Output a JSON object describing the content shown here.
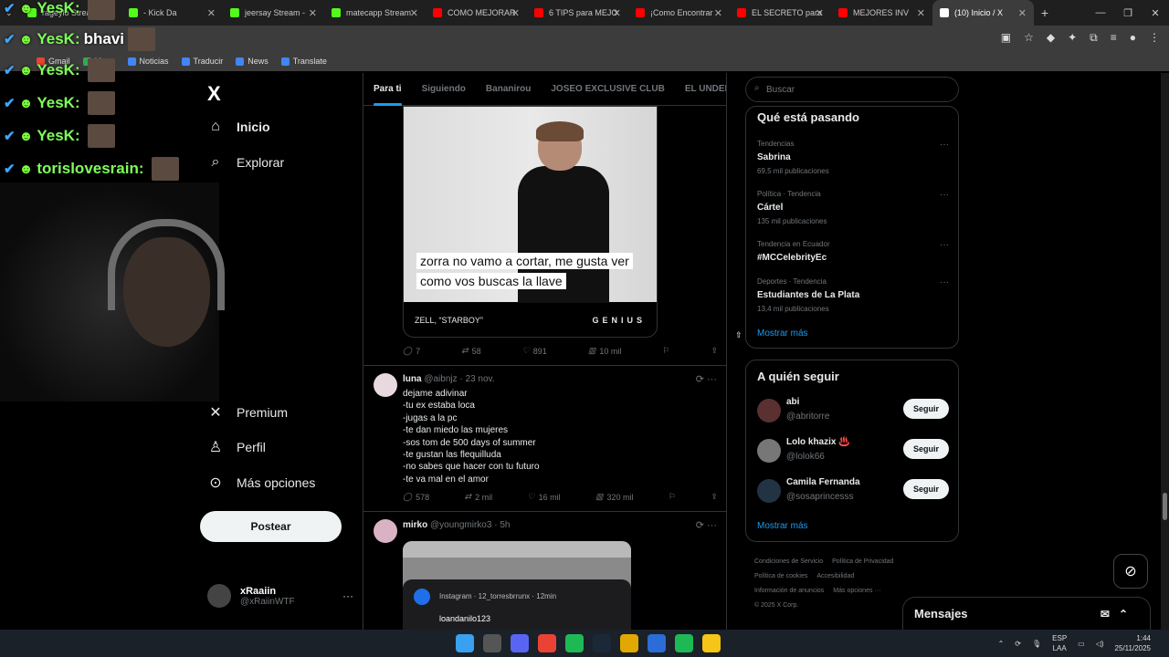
{
  "browser": {
    "tabs": [
      {
        "title": "rageylo Strea",
        "color": "#53fc18"
      },
      {
        "title": "- Kick Da",
        "color": "#53fc18"
      },
      {
        "title": "jeersay Stream - ",
        "color": "#53fc18"
      },
      {
        "title": "matecapp Stream",
        "color": "#53fc18"
      },
      {
        "title": "COMO MEJORAR",
        "color": "#ff0000"
      },
      {
        "title": "6 TIPS para MEJO",
        "color": "#ff0000"
      },
      {
        "title": "¡Como Encontrar",
        "color": "#ff0000"
      },
      {
        "title": "EL SECRETO para",
        "color": "#ff0000"
      },
      {
        "title": "MEJORES INV",
        "color": "#ff0000"
      },
      {
        "title": "(10) Inicio / X",
        "color": "#ffffff"
      }
    ],
    "bookmarks": [
      {
        "label": "Gmail",
        "color": "#ea4335"
      },
      {
        "label": "Maps",
        "color": "#34a853"
      },
      {
        "label": "Noticias",
        "color": "#4285f4"
      },
      {
        "label": "Traducir",
        "color": "#4285f4"
      },
      {
        "label": "News",
        "color": "#4285f4"
      },
      {
        "label": "Translate",
        "color": "#4285f4"
      }
    ]
  },
  "overlay": {
    "chat": [
      {
        "nick": "YesK:",
        "text": ""
      },
      {
        "nick": "YesK:",
        "text": "bhavi"
      },
      {
        "nick": "YesK:",
        "text": ""
      },
      {
        "nick": "YesK:",
        "text": ""
      },
      {
        "nick": "YesK:",
        "text": ""
      },
      {
        "nick": "torislovesrain:",
        "text": ""
      }
    ]
  },
  "nav": {
    "logo": "X",
    "items": [
      {
        "label": "Inicio",
        "icon": "home-icon"
      },
      {
        "label": "Explorar",
        "icon": "search-icon"
      },
      {
        "label": "Premium",
        "icon": "x-premium-icon"
      },
      {
        "label": "Perfil",
        "icon": "person-icon"
      },
      {
        "label": "Más opciones",
        "icon": "more-circle-icon"
      }
    ],
    "post_label": "Postear",
    "profile": {
      "name": "xRaaiin",
      "handle": "@xRaiinWTF"
    }
  },
  "feed": {
    "tabs": [
      "Para ti",
      "Siguiendo",
      "Bananirou",
      "JOSEO EXCLUSIVE CLUB",
      "EL UNDER."
    ],
    "post1": {
      "caption_line1": "zorra no vamo a cortar, me gusta ver",
      "caption_line2": "como vos buscas la llave",
      "source": "ZELL, “STARBOY”",
      "brand": "GENIUS",
      "replies": "7",
      "reposts": "58",
      "likes": "891",
      "views": "10 mil"
    },
    "post2": {
      "name": "luna",
      "handle": "@aibnjz",
      "time": "23 nov.",
      "lines": [
        "dejame adivinar",
        "-tu ex estaba loca",
        "-jugas a la pc",
        "-te dan miedo las mujeres",
        "-sos tom de 500 days of summer",
        "-te gustan las flequilluda",
        "-no sabes que hacer con tu futuro",
        "-te va mal en el amor"
      ],
      "replies": "578",
      "reposts": "2 mil",
      "likes": "16 mil",
      "views": "320 mil"
    },
    "post3": {
      "name": "mirko",
      "handle": "@youngmirko3",
      "time": "5h",
      "notif_meta": "Instagram · 12_torresbrrunx · 12min",
      "notif_user": "loandanilo123"
    }
  },
  "sidebar": {
    "search_placeholder": "Buscar",
    "trends_title": "Qué está pasando",
    "trends": [
      {
        "context": "Tendencias",
        "name": "Sabrina",
        "count": "69,5 mil publicaciones"
      },
      {
        "context": "Política · Tendencia",
        "name": "Cártel",
        "count": "135 mil publicaciones"
      },
      {
        "context": "Tendencia en Ecuador",
        "name": "#MCCelebrityEc",
        "count": ""
      },
      {
        "context": "Deportes · Tendencia",
        "name": "Estudiantes de La Plata",
        "count": "13,4 mil publicaciones"
      }
    ],
    "show_more": "Mostrar más",
    "follow_title": "A quién seguir",
    "follow": [
      {
        "name": "abi",
        "handle": "@abritorre"
      },
      {
        "name": "Lolo khazix ♨️",
        "handle": "@lolok66"
      },
      {
        "name": "Camila Fernanda",
        "handle": "@sosaprincesss"
      }
    ],
    "follow_button": "Seguir",
    "footer": [
      "Condiciones de Servicio",
      "Política de Privacidad",
      "Política de cookies",
      "Accesibilidad",
      "Información de anuncios",
      "Más opciones ···",
      "© 2025 X Corp."
    ]
  },
  "messages_label": "Mensajes",
  "taskbar": {
    "lang1": "ESP",
    "lang2": "LAA",
    "time": "1:44",
    "date": "25/11/2025"
  }
}
